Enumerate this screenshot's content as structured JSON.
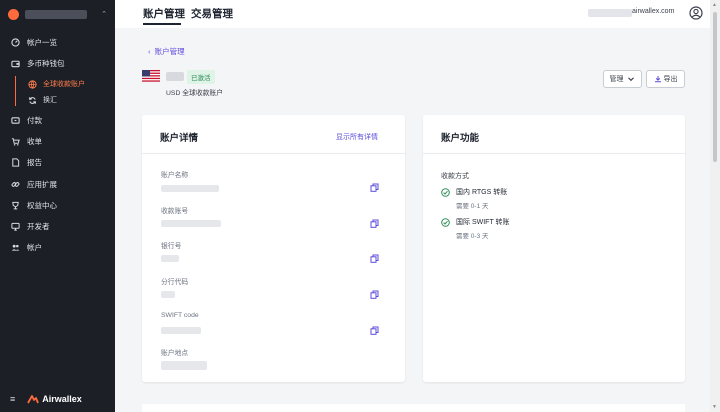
{
  "sidebar": {
    "nav": [
      {
        "label": "帐户一览",
        "icon": "dashboard-icon"
      },
      {
        "label": "多币种钱包",
        "icon": "wallet-icon"
      },
      {
        "label": "付款",
        "icon": "payment-icon"
      },
      {
        "label": "收单",
        "icon": "cart-icon"
      },
      {
        "label": "报告",
        "icon": "report-icon"
      },
      {
        "label": "应用扩展",
        "icon": "link-icon"
      },
      {
        "label": "权益中心",
        "icon": "trophy-icon"
      },
      {
        "label": "开发者",
        "icon": "monitor-icon"
      },
      {
        "label": "帐户",
        "icon": "people-icon"
      }
    ],
    "sub": [
      {
        "label": "全球收款账户",
        "active": true,
        "icon": "globe-icon"
      },
      {
        "label": "换汇",
        "active": false,
        "icon": "refresh-icon"
      }
    ],
    "brand": "Airwallex"
  },
  "topbar": {
    "tabs": [
      "账户管理",
      "交易管理"
    ],
    "email_suffix": "airwallex.com"
  },
  "account": {
    "back": "账户管理",
    "badge": "已激活",
    "subtitle": "USD 全球收款账户",
    "manage_btn": "管理",
    "export_btn": "导出"
  },
  "details": {
    "title": "账户详情",
    "show_all": "显示所有详情",
    "fields": [
      "账户名称",
      "收款账号",
      "银行号",
      "分行代码",
      "SWIFT code",
      "账户地点"
    ]
  },
  "features": {
    "title": "账户功能",
    "section": "收款方式",
    "items": [
      {
        "name": "国内 RTGS 转账",
        "time": "需要 0-1 天"
      },
      {
        "name": "国际 SWIFT 转账",
        "time": "需要 0-3 天"
      }
    ]
  },
  "colors": {
    "accent": "#ff6b3d",
    "link": "#5b4bdc",
    "success": "#2e8b57",
    "sidebar": "#1c1f26"
  }
}
